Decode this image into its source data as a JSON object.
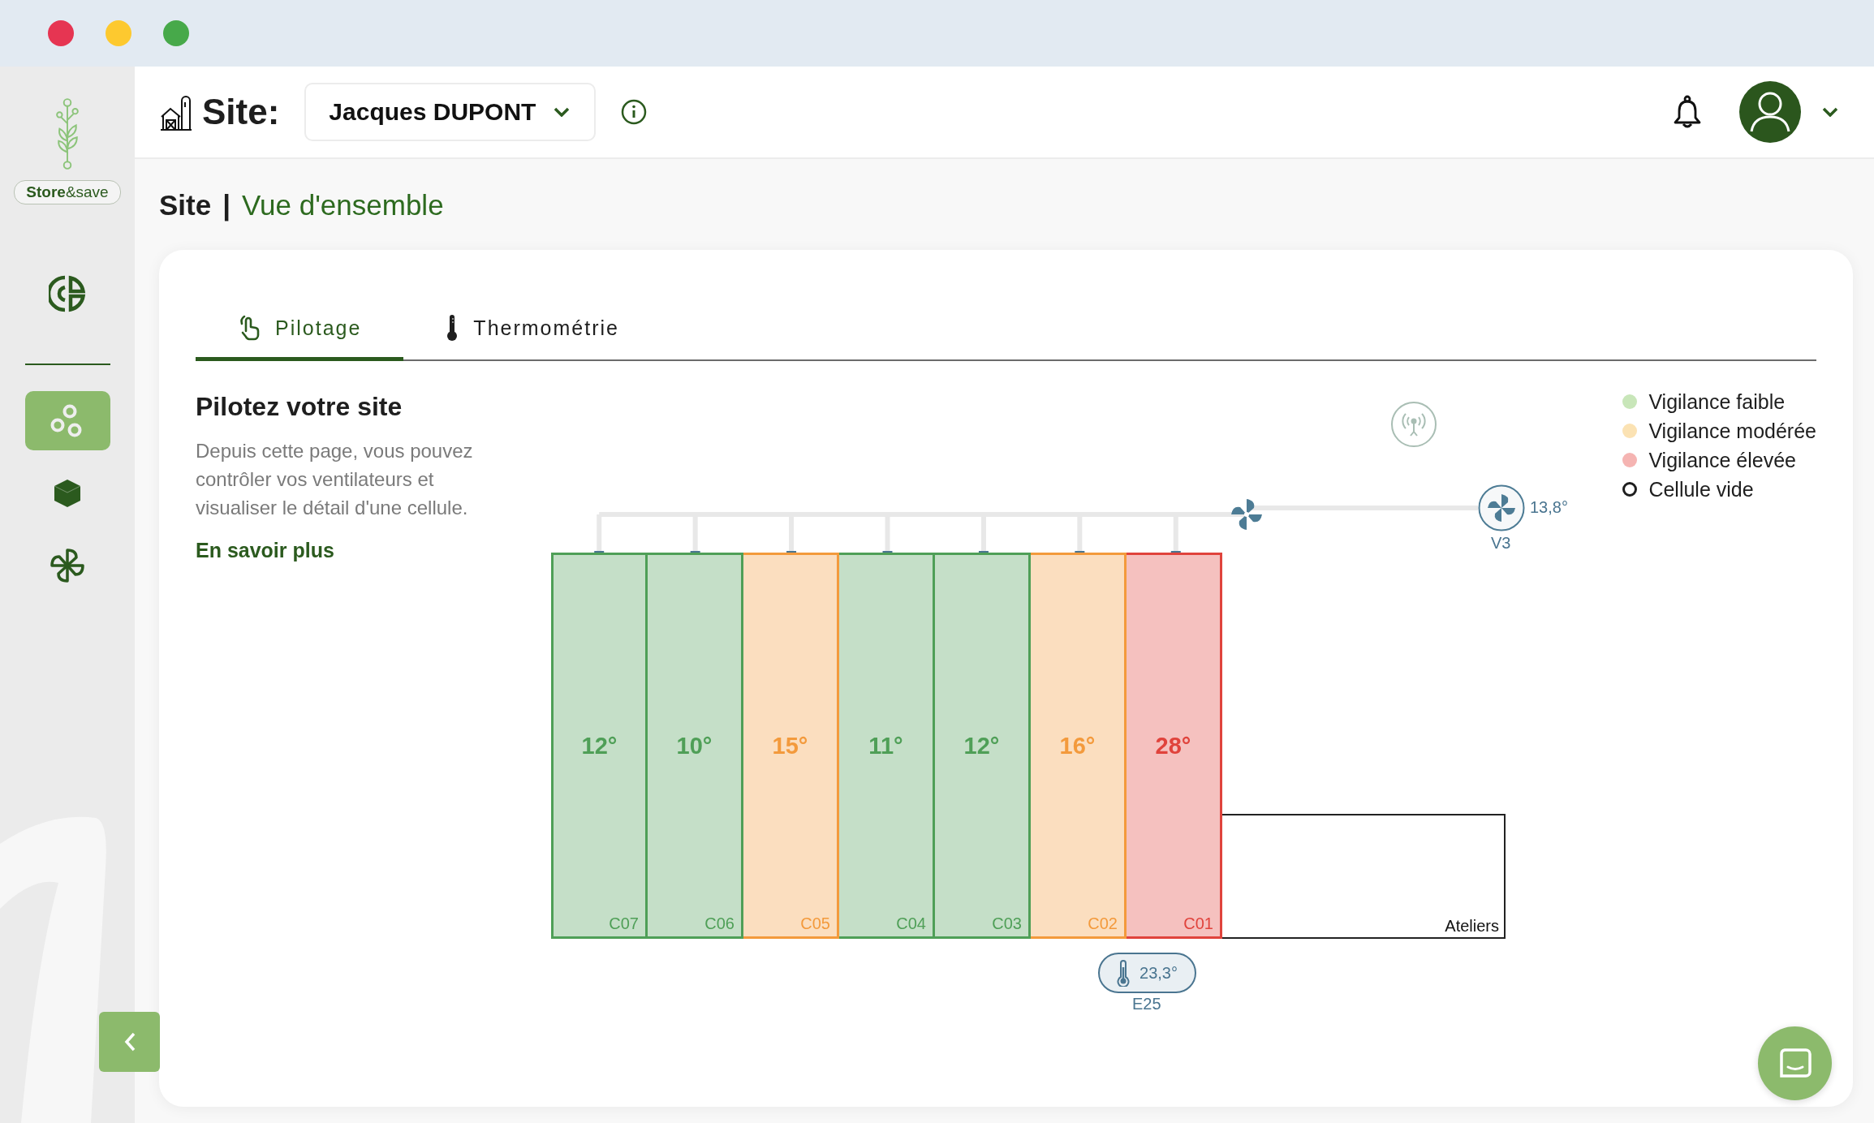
{
  "sidebar": {
    "logo_text": "**Store**&save",
    "top_items": [
      {
        "kind": "segments",
        "selected": false
      }
    ],
    "items": [
      {
        "kind": "circles",
        "selected": true
      },
      {
        "kind": "cube",
        "selected": false
      },
      {
        "kind": "fan",
        "selected": false
      }
    ]
  },
  "header": {
    "title": "Site:",
    "site_select": {
      "value": "Jacques DUPONT"
    }
  },
  "breadcrumb": {
    "section": "Site",
    "separator": "|",
    "page": "Vue d'ensemble"
  },
  "tabs": [
    {
      "label": "Pilotage",
      "kind": "touch",
      "selected": true
    },
    {
      "label": "Thermométrie",
      "kind": "thermometer",
      "selected": false
    }
  ],
  "intro": {
    "heading": "Pilotez votre site",
    "description": "Depuis cette page, vous pouvez contrôler vos ventilateurs et visualiser le détail d'une cellule.",
    "link": "En savoir plus"
  },
  "diagram": {
    "cells": [
      {
        "name": "C07",
        "temperature": "12°",
        "color": "#4f9f57"
      },
      {
        "name": "C06",
        "temperature": "10°",
        "color": "#4f9f57"
      },
      {
        "name": "C05",
        "temperature": "15°",
        "color": "#f39a3c"
      },
      {
        "name": "C04",
        "temperature": "11°",
        "color": "#4f9f57"
      },
      {
        "name": "C03",
        "temperature": "12°",
        "color": "#4f9f57"
      },
      {
        "name": "C02",
        "temperature": "16°",
        "color": "#f39a3c"
      },
      {
        "name": "C01",
        "temperature": "28°",
        "color": "#e0433c"
      }
    ],
    "workshop": {
      "label": "Ateliers"
    },
    "fan_unit": {
      "label": "V3",
      "reading": "13,8°"
    },
    "probe": {
      "label": "E25",
      "reading": "23,3°"
    }
  },
  "legend": [
    {
      "label": "Vigilance faible",
      "kind": "dot",
      "color": "#c8e6b9"
    },
    {
      "label": "Vigilance modérée",
      "kind": "dot",
      "color": "#fbe2b3"
    },
    {
      "label": "Vigilance élevée",
      "kind": "dot",
      "color": "#f5b4b2"
    },
    {
      "label": "Cellule vide",
      "kind": "ring",
      "color": "#1e1e1e"
    }
  ]
}
